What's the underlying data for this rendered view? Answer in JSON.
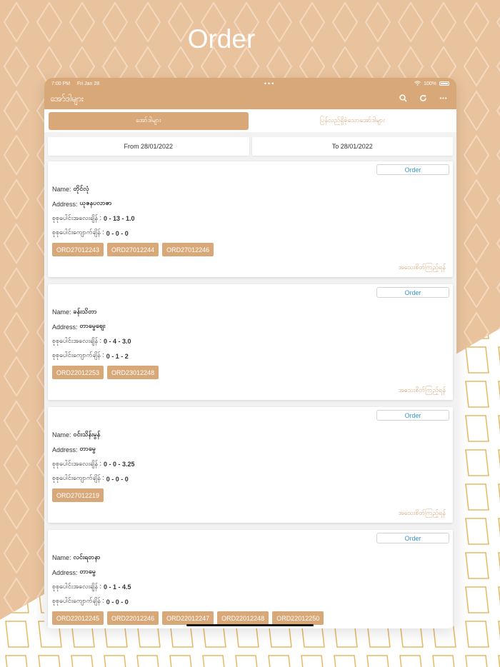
{
  "hero": {
    "title": "Order"
  },
  "status_bar": {
    "time": "7:00 PM",
    "date": "Fri Jan 28",
    "center": "•••",
    "battery": "100%"
  },
  "app_bar": {
    "title": "အော်ဒါများ"
  },
  "tabs": [
    {
      "label": "အော်ဒါများ",
      "active": true
    },
    {
      "label": "ပြန်လည်ရှိခဲ့သောအော်ဒါများ",
      "active": false
    }
  ],
  "date_filter": {
    "from": "From 28/01/2022",
    "to": "To 28/01/2022"
  },
  "orders": [
    {
      "order_label": "Order",
      "name_label": "Name:",
      "name": "တိုင်လုံ",
      "address_label": "Address:",
      "address": "ယုဇနပလာဇာ",
      "weight_label": "စုစုပေါင်းအလေးချိန် :",
      "weight": "0 - 13 - 1.0",
      "balance_label": "စုစုပေါင်းကျောက်ချိန် :",
      "balance": "0 - 0 - 0",
      "codes": [
        "ORD27012243",
        "ORD27012244",
        "ORD27012246"
      ],
      "detail_label": "အသေးစိတ်ကြည့်ရန်"
    },
    {
      "order_label": "Order",
      "name_label": "Name:",
      "name": "ခန်းသိတာ",
      "address_label": "Address:",
      "address": "တာမွေဈေး",
      "weight_label": "စုစုပေါင်းအလေးချိန် :",
      "weight": "0 - 4 - 3.0",
      "balance_label": "စုစုပေါင်းကျောက်ချိန် :",
      "balance": "0 - 1 - 2",
      "codes": [
        "ORD22012253",
        "ORD23012248"
      ],
      "detail_label": "အသေးစိတ်ကြည့်ရန်"
    },
    {
      "order_label": "Order",
      "name_label": "Name:",
      "name": "ဝင်းသိန်းမွန်",
      "address_label": "Address:",
      "address": "တာမွေ",
      "weight_label": "စုစုပေါင်းအလေးချိန် :",
      "weight": "0 - 0 - 3.25",
      "balance_label": "စုစုပေါင်းကျောက်ချိန် :",
      "balance": "0 - 0 - 0",
      "codes": [
        "ORD27012219"
      ],
      "detail_label": "အသေးစိတ်ကြည့်ရန်"
    },
    {
      "order_label": "Order",
      "name_label": "Name:",
      "name": "လင်းရတနာ",
      "address_label": "Address:",
      "address": "တာမွေ",
      "weight_label": "စုစုပေါင်းအလေးချိန် :",
      "weight": "0 - 1 - 4.5",
      "balance_label": "စုစုပေါင်းကျောက်ချိန် :",
      "balance": "0 - 0 - 0",
      "codes": [
        "ORD22012245",
        "ORD22012246",
        "ORD22012247",
        "ORD22012248",
        "ORD22012250"
      ],
      "detail_label": ""
    }
  ],
  "colors": {
    "accent": "#d8a878",
    "link": "#3a9ad9",
    "background": "#e9c39d"
  },
  "icons": [
    "search-icon",
    "refresh-icon",
    "more-icon",
    "wifi-icon",
    "battery-icon"
  ]
}
